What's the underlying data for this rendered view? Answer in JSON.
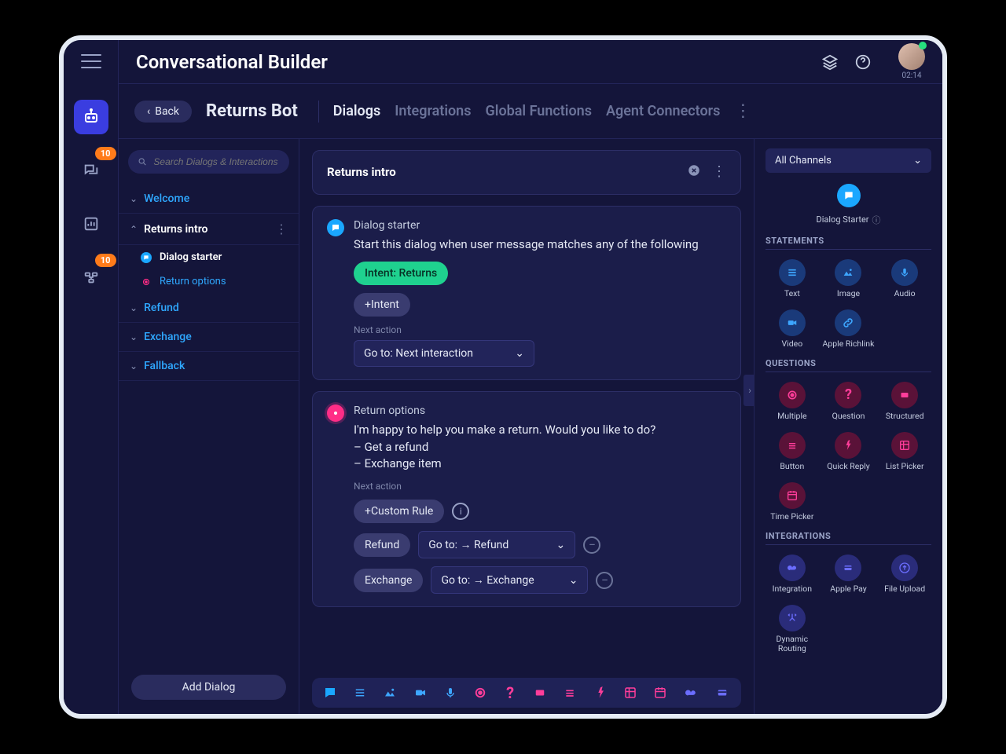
{
  "app_title": "Conversational Builder",
  "timer": "02:14",
  "badges": {
    "conversations": "10",
    "flows": "10"
  },
  "back_label": "Back",
  "bot_name": "Returns Bot",
  "tabs": [
    "Dialogs",
    "Integrations",
    "Global Functions",
    "Agent Connectors"
  ],
  "search_placeholder": "Search Dialogs & Interactions",
  "dialogs": {
    "welcome": "Welcome",
    "returns_intro": "Returns intro",
    "refund": "Refund",
    "exchange": "Exchange",
    "fallback": "Fallback",
    "children": {
      "dialog_starter": "Dialog starter",
      "return_options": "Return options"
    }
  },
  "add_dialog": "Add Dialog",
  "canvas_title": "Returns intro",
  "starter": {
    "title": "Dialog starter",
    "description": "Start this dialog when user message matches any of the following",
    "intent_chip": "Intent: Returns",
    "add_intent": "+Intent",
    "next_action_label": "Next action",
    "next_action_value": "Go to: Next interaction"
  },
  "options_node": {
    "title": "Return options",
    "body": "I'm happy to help you make a return. Would you like to do?\n– Get a refund\n– Exchange item",
    "next_action_label": "Next action",
    "custom_rule": "+Custom Rule",
    "rules": [
      {
        "label": "Refund",
        "target": "Go to: → Refund"
      },
      {
        "label": "Exchange",
        "target": "Go to: → Exchange"
      }
    ]
  },
  "palette": {
    "channel_select": "All Channels",
    "starter_label": "Dialog Starter",
    "sections": {
      "statements": "STATEMENTS",
      "questions": "QUESTIONS",
      "integrations": "INTEGRATIONS"
    },
    "statements": [
      "Text",
      "Image",
      "Audio",
      "Video",
      "Apple Richlink"
    ],
    "questions": [
      "Multiple",
      "Question",
      "Structured",
      "Button",
      "Quick Reply",
      "List Picker",
      "Time Picker"
    ],
    "integrations": [
      "Integration",
      "Apple Pay",
      "File Upload",
      "Dynamic Routing"
    ]
  }
}
